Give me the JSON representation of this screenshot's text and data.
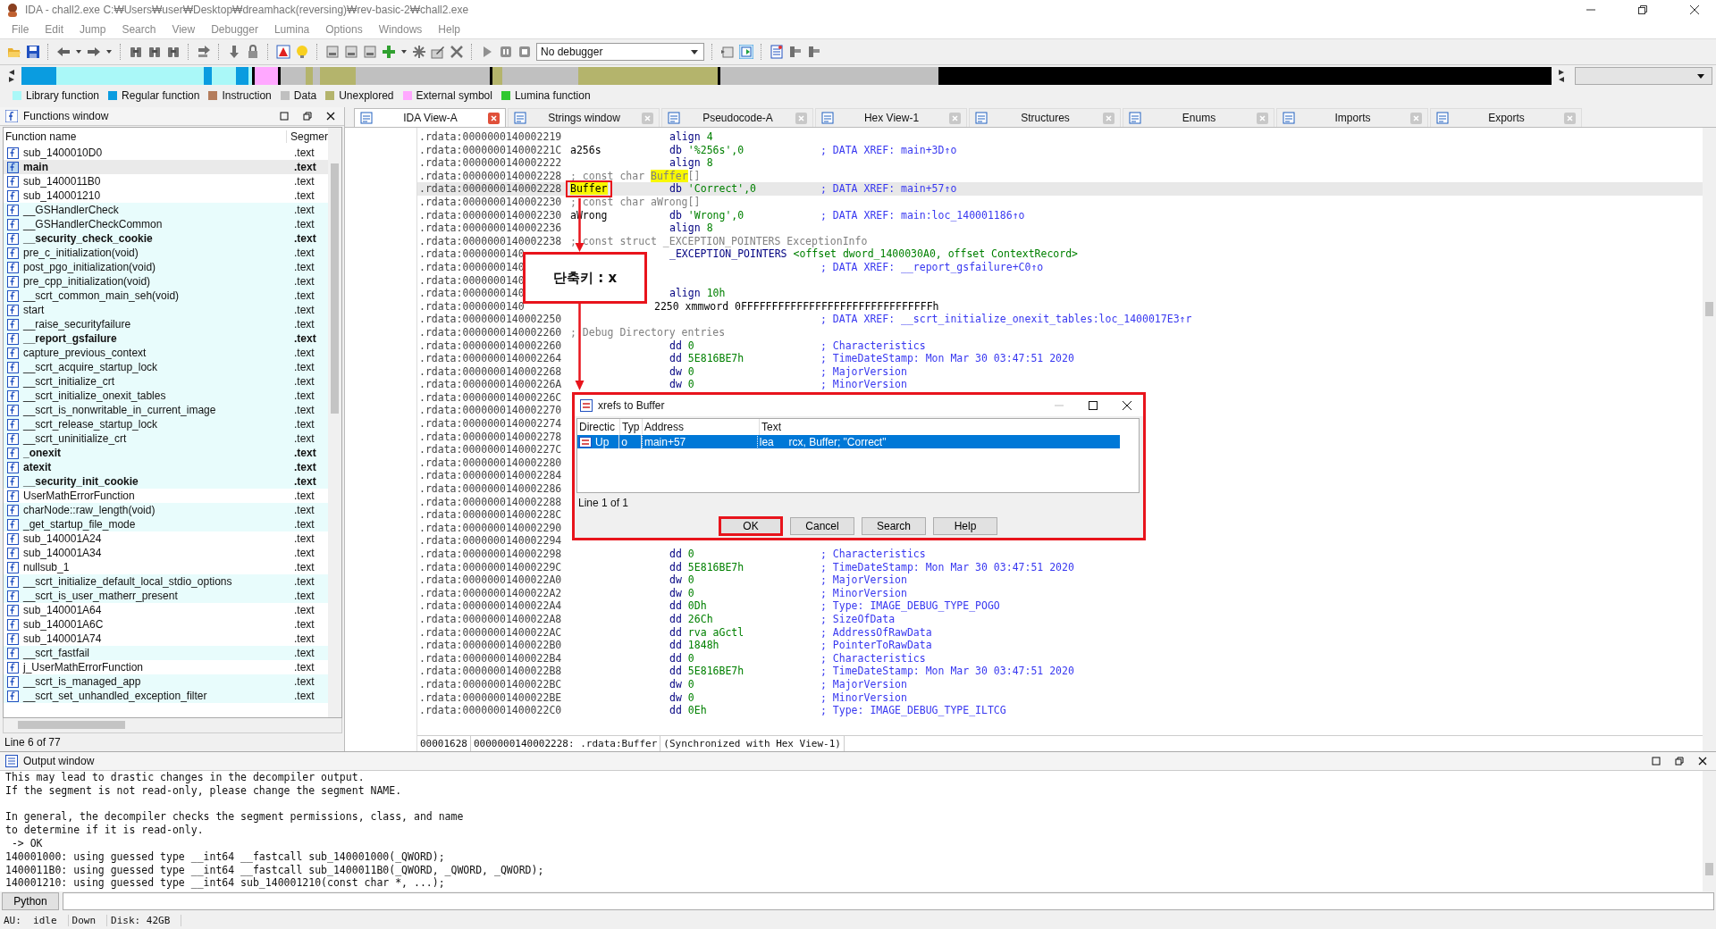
{
  "window": {
    "title": "IDA - chall2.exe C:₩Users₩user₩Desktop₩dreamhack(reversing)₩rev-basic-2₩chall2.exe"
  },
  "menu": [
    "File",
    "Edit",
    "Jump",
    "Search",
    "View",
    "Debugger",
    "Lumina",
    "Options",
    "Windows",
    "Help"
  ],
  "toolbar": {
    "debugger_select": "No debugger"
  },
  "legend": [
    {
      "label": "Library function",
      "color": "#aaf8f8"
    },
    {
      "label": "Regular function",
      "color": "#0a9ce0"
    },
    {
      "label": "Instruction",
      "color": "#b47c5c"
    },
    {
      "label": "Data",
      "color": "#c0c0c0"
    },
    {
      "label": "Unexplored",
      "color": "#b4b46c"
    },
    {
      "label": "External symbol",
      "color": "#ffa8ff"
    },
    {
      "label": "Lumina function",
      "color": "#30c830"
    }
  ],
  "functions_window": {
    "title": "Functions window",
    "columns": [
      "Function name",
      "Segmer"
    ],
    "rows": [
      {
        "name": "sub_1400010D0",
        "segment": ".text",
        "bold": false,
        "library": false,
        "selected": false
      },
      {
        "name": "main",
        "segment": ".text",
        "bold": true,
        "library": false,
        "selected": true
      },
      {
        "name": "sub_1400011B0",
        "segment": ".text",
        "bold": false,
        "library": false,
        "selected": false
      },
      {
        "name": "sub_140001210",
        "segment": ".text",
        "bold": false,
        "library": false,
        "selected": false
      },
      {
        "name": "__GSHandlerCheck",
        "segment": ".text",
        "bold": false,
        "library": true,
        "selected": false
      },
      {
        "name": "__GSHandlerCheckCommon",
        "segment": ".text",
        "bold": false,
        "library": true,
        "selected": false
      },
      {
        "name": "__security_check_cookie",
        "segment": ".text",
        "bold": true,
        "library": true,
        "selected": false
      },
      {
        "name": "pre_c_initialization(void)",
        "segment": ".text",
        "bold": false,
        "library": true,
        "selected": false
      },
      {
        "name": "post_pgo_initialization(void)",
        "segment": ".text",
        "bold": false,
        "library": true,
        "selected": false
      },
      {
        "name": "pre_cpp_initialization(void)",
        "segment": ".text",
        "bold": false,
        "library": true,
        "selected": false
      },
      {
        "name": "__scrt_common_main_seh(void)",
        "segment": ".text",
        "bold": false,
        "library": true,
        "selected": false
      },
      {
        "name": "start",
        "segment": ".text",
        "bold": false,
        "library": true,
        "selected": false
      },
      {
        "name": "__raise_securityfailure",
        "segment": ".text",
        "bold": false,
        "library": true,
        "selected": false
      },
      {
        "name": "__report_gsfailure",
        "segment": ".text",
        "bold": true,
        "library": true,
        "selected": false
      },
      {
        "name": "capture_previous_context",
        "segment": ".text",
        "bold": false,
        "library": true,
        "selected": false
      },
      {
        "name": "__scrt_acquire_startup_lock",
        "segment": ".text",
        "bold": false,
        "library": true,
        "selected": false
      },
      {
        "name": "__scrt_initialize_crt",
        "segment": ".text",
        "bold": false,
        "library": true,
        "selected": false
      },
      {
        "name": "__scrt_initialize_onexit_tables",
        "segment": ".text",
        "bold": false,
        "library": true,
        "selected": false
      },
      {
        "name": "__scrt_is_nonwritable_in_current_image",
        "segment": ".text",
        "bold": false,
        "library": true,
        "selected": false
      },
      {
        "name": "__scrt_release_startup_lock",
        "segment": ".text",
        "bold": false,
        "library": true,
        "selected": false
      },
      {
        "name": "__scrt_uninitialize_crt",
        "segment": ".text",
        "bold": false,
        "library": true,
        "selected": false
      },
      {
        "name": "_onexit",
        "segment": ".text",
        "bold": true,
        "library": true,
        "selected": false
      },
      {
        "name": "atexit",
        "segment": ".text",
        "bold": true,
        "library": true,
        "selected": false
      },
      {
        "name": "__security_init_cookie",
        "segment": ".text",
        "bold": true,
        "library": true,
        "selected": false
      },
      {
        "name": "UserMathErrorFunction",
        "segment": ".text",
        "bold": false,
        "library": false,
        "selected": false
      },
      {
        "name": "charNode::raw_length(void)",
        "segment": ".text",
        "bold": false,
        "library": true,
        "selected": false
      },
      {
        "name": "_get_startup_file_mode",
        "segment": ".text",
        "bold": false,
        "library": true,
        "selected": false
      },
      {
        "name": "sub_140001A24",
        "segment": ".text",
        "bold": false,
        "library": false,
        "selected": false
      },
      {
        "name": "sub_140001A34",
        "segment": ".text",
        "bold": false,
        "library": false,
        "selected": false
      },
      {
        "name": "nullsub_1",
        "segment": ".text",
        "bold": false,
        "library": false,
        "selected": false
      },
      {
        "name": "__scrt_initialize_default_local_stdio_options",
        "segment": ".text",
        "bold": false,
        "library": true,
        "selected": false
      },
      {
        "name": "__scrt_is_user_matherr_present",
        "segment": ".text",
        "bold": false,
        "library": true,
        "selected": false
      },
      {
        "name": "sub_140001A64",
        "segment": ".text",
        "bold": false,
        "library": false,
        "selected": false
      },
      {
        "name": "sub_140001A6C",
        "segment": ".text",
        "bold": false,
        "library": false,
        "selected": false
      },
      {
        "name": "sub_140001A74",
        "segment": ".text",
        "bold": false,
        "library": false,
        "selected": false
      },
      {
        "name": "__scrt_fastfail",
        "segment": ".text",
        "bold": false,
        "library": true,
        "selected": false
      },
      {
        "name": "j_UserMathErrorFunction",
        "segment": ".text",
        "bold": false,
        "library": false,
        "selected": false
      },
      {
        "name": "__scrt_is_managed_app",
        "segment": ".text",
        "bold": false,
        "library": true,
        "selected": false
      },
      {
        "name": "__scrt_set_unhandled_exception_filter",
        "segment": ".text",
        "bold": false,
        "library": true,
        "selected": false
      }
    ],
    "status": "Line 6 of 77"
  },
  "tabs": [
    {
      "label": "IDA View-A",
      "selected": true
    },
    {
      "label": "Strings window",
      "selected": false
    },
    {
      "label": "Pseudocode-A",
      "selected": false
    },
    {
      "label": "Hex View-1",
      "selected": false
    },
    {
      "label": "Structures",
      "selected": false
    },
    {
      "label": "Enums",
      "selected": false
    },
    {
      "label": "Imports",
      "selected": false
    },
    {
      "label": "Exports",
      "selected": false
    }
  ],
  "listing": {
    "lines": [
      {
        "addr": ".rdata:0000000140002219",
        "op": "align",
        "args": "4",
        "selected": false
      },
      {
        "addr": ".rdata:000000014000221C",
        "label": "a256s",
        "label_highlight": false,
        "op": "db",
        "args": "'%256s',0",
        "comment": "; DATA XREF: main+3D↑o",
        "selected": false
      },
      {
        "addr": ".rdata:0000000140002222",
        "op": "align",
        "args": "8",
        "selected": false
      },
      {
        "addr": ".rdata:0000000140002228",
        "note": [
          {
            "text": "; const char ",
            "highlight": false
          },
          {
            "text": "Buffer",
            "highlight": true
          },
          {
            "text": "[]",
            "highlight": false
          }
        ],
        "selected": false
      },
      {
        "addr": ".rdata:0000000140002228",
        "label": "Buffer",
        "label_highlight": true,
        "op": "db",
        "args": "'Correct',0",
        "comment": "; DATA XREF: main+57↑o",
        "selected": true
      },
      {
        "addr": ".rdata:0000000140002230",
        "note": [
          {
            "text": "; const char aWrong[]",
            "highlight": false
          }
        ],
        "selected": false
      },
      {
        "addr": ".rdata:0000000140002230",
        "label": "aWrong",
        "label_highlight": false,
        "op": "db",
        "args": "'Wrong',0",
        "comment": "; DATA XREF: main:loc_140001186↑o",
        "selected": false
      },
      {
        "addr": ".rdata:0000000140002236",
        "op": "align",
        "args": "8",
        "selected": false
      },
      {
        "addr": ".rdata:0000000140002238",
        "note": [
          {
            "text": "; const struct _EXCEPTION_POINTERS ExceptionInfo",
            "highlight": false
          }
        ],
        "selected": false
      },
      {
        "addr": ".rdata:0000000140",
        "op": "_EXCEPTION_POINTERS",
        "args": "<offset dword_1400030A0, offset ContextRecord>",
        "selected": false
      },
      {
        "addr": ".rdata:0000000140",
        "comment": "; DATA XREF: __report_gsfailure+C0↑o",
        "selected": false
      },
      {
        "addr": ".rdata:0000000140",
        "selected": false
      },
      {
        "addr": ".rdata:0000000140",
        "op": "align",
        "args": "10h",
        "selected": false
      },
      {
        "addr": ".rdata:0000000140",
        "wide": "2250 xmmword 0FFFFFFFFFFFFFFFFFFFFFFFFFFFFFFFh",
        "selected": false
      },
      {
        "addr": ".rdata:0000000140002250",
        "comment": "; DATA XREF: __scrt_initialize_onexit_tables:loc_1400017E3↑r",
        "selected": false
      },
      {
        "addr": ".rdata:0000000140002260",
        "note": [
          {
            "text": "; Debug Directory entries",
            "highlight": false
          }
        ],
        "selected": false
      },
      {
        "addr": ".rdata:0000000140002260",
        "op": "dd",
        "args": "0",
        "comment": "; Characteristics",
        "selected": false
      },
      {
        "addr": ".rdata:0000000140002264",
        "op": "dd",
        "args": "5E816BE7h",
        "comment": "; TimeDateStamp: Mon Mar 30 03:47:51 2020",
        "selected": false
      },
      {
        "addr": ".rdata:0000000140002268",
        "op": "dw",
        "args": "0",
        "comment": "; MajorVersion",
        "selected": false
      },
      {
        "addr": ".rdata:000000014000226A",
        "op": "dw",
        "args": "0",
        "comment": "; MinorVersion",
        "selected": false
      },
      {
        "addr": ".rdata:000000014000226C",
        "selected": false
      },
      {
        "addr": ".rdata:0000000140002270",
        "selected": false
      },
      {
        "addr": ".rdata:0000000140002274",
        "selected": false
      },
      {
        "addr": ".rdata:0000000140002278",
        "selected": false
      },
      {
        "addr": ".rdata:000000014000227C",
        "selected": false
      },
      {
        "addr": ".rdata:0000000140002280",
        "selected": false
      },
      {
        "addr": ".rdata:0000000140002284",
        "selected": false
      },
      {
        "addr": ".rdata:0000000140002286",
        "selected": false
      },
      {
        "addr": ".rdata:0000000140002288",
        "selected": false
      },
      {
        "addr": ".rdata:000000014000228C",
        "selected": false
      },
      {
        "addr": ".rdata:0000000140002290",
        "selected": false
      },
      {
        "addr": ".rdata:0000000140002294",
        "selected": false
      },
      {
        "addr": ".rdata:0000000140002298",
        "op": "dd",
        "args": "0",
        "comment": "; Characteristics",
        "selected": false
      },
      {
        "addr": ".rdata:000000014000229C",
        "op": "dd",
        "args": "5E816BE7h",
        "comment": "; TimeDateStamp: Mon Mar 30 03:47:51 2020",
        "selected": false
      },
      {
        "addr": ".rdata:00000001400022A0",
        "op": "dw",
        "args": "0",
        "comment": "; MajorVersion",
        "selected": false
      },
      {
        "addr": ".rdata:00000001400022A2",
        "op": "dw",
        "args": "0",
        "comment": "; MinorVersion",
        "selected": false
      },
      {
        "addr": ".rdata:00000001400022A4",
        "op": "dd",
        "args": "0Dh",
        "comment": "; Type: IMAGE_DEBUG_TYPE_POGO",
        "selected": false
      },
      {
        "addr": ".rdata:00000001400022A8",
        "op": "dd",
        "args": "26Ch",
        "comment": "; SizeOfData",
        "selected": false
      },
      {
        "addr": ".rdata:00000001400022AC",
        "op": "dd",
        "args": "rva aGctl",
        "comment": "; AddressOfRawData",
        "selected": false
      },
      {
        "addr": ".rdata:00000001400022B0",
        "op": "dd",
        "args": "1848h",
        "comment": "; PointerToRawData",
        "selected": false
      },
      {
        "addr": ".rdata:00000001400022B4",
        "op": "dd",
        "args": "0",
        "comment": "; Characteristics",
        "selected": false
      },
      {
        "addr": ".rdata:00000001400022B8",
        "op": "dd",
        "args": "5E816BE7h",
        "comment": "; TimeDateStamp: Mon Mar 30 03:47:51 2020",
        "selected": false
      },
      {
        "addr": ".rdata:00000001400022BC",
        "op": "dw",
        "args": "0",
        "comment": "; MajorVersion",
        "selected": false
      },
      {
        "addr": ".rdata:00000001400022BE",
        "op": "dw",
        "args": "0",
        "comment": "; MinorVersion",
        "selected": false
      },
      {
        "addr": ".rdata:00000001400022C0",
        "op": "dd",
        "args": "0Eh",
        "comment": "; Type: IMAGE_DEBUG_TYPE_ILTCG",
        "selected": false
      }
    ],
    "status": [
      "00001628",
      "0000000140002228: .rdata:Buffer",
      "(Synchronized with Hex View-1)"
    ]
  },
  "callout": {
    "text": "단축키 : x"
  },
  "dialog": {
    "title": "xrefs to Buffer",
    "columns": [
      "Directic",
      "Typ",
      "Address",
      "Text"
    ],
    "rows": [
      {
        "direction": "Up",
        "type": "o",
        "address": "main+57",
        "text": "lea     rcx, Buffer; \"Correct\"",
        "selected": true
      }
    ],
    "status": "Line 1 of 1",
    "buttons": [
      "OK",
      "Cancel",
      "Search",
      "Help"
    ]
  },
  "output_window": {
    "title": "Output window",
    "blocks": [
      [
        "This may lead to drastic changes in the decompiler output.",
        "If the segment is not read-only, please change the segment NAME."
      ],
      [
        "In general, the decompiler checks the segment permissions, class, and name",
        "to determine if it is read-only.",
        " -> OK",
        "140001000: using guessed type __int64 __fastcall sub_140001000(_QWORD);",
        "1400011B0: using guessed type __int64 __fastcall sub_1400011B0(_QWORD, _QWORD, _QWORD);",
        "140001210: using guessed type __int64 sub_140001210(const char *, ...);"
      ]
    ],
    "language_button": "Python"
  },
  "status_bar": [
    "AU:  idle",
    "Down",
    "Disk: 42GB"
  ]
}
